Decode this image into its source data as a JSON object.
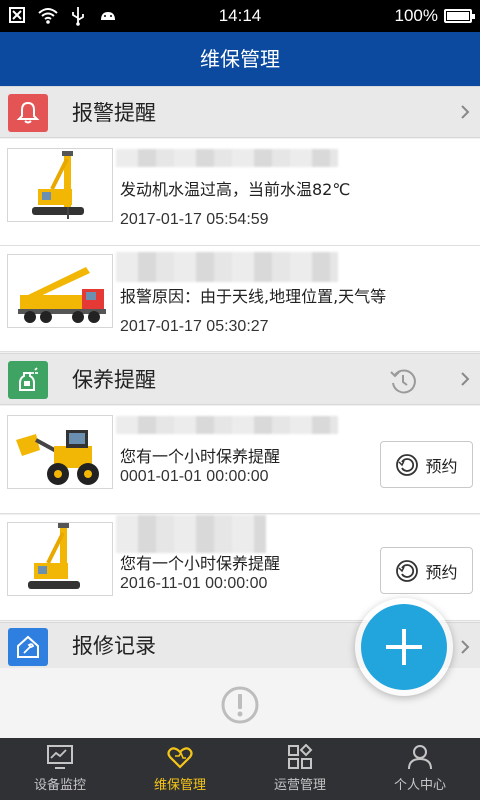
{
  "status_bar": {
    "time": "14:14",
    "battery_text": "100%",
    "battery_level": 1.0
  },
  "header": {
    "title": "维保管理"
  },
  "alarm_section": {
    "title": "报警提醒",
    "items": [
      {
        "message": "发动机水温过高，当前水温82℃",
        "timestamp": "2017-01-17 05:54:59",
        "thumbnail": "rotary-drilling-rig"
      },
      {
        "message": "报警原因：由于天线,地理位置,天气等",
        "timestamp": "2017-01-17 05:30:27",
        "thumbnail": "truck-crane"
      }
    ]
  },
  "maintenance_section": {
    "title": "保养提醒",
    "items": [
      {
        "message": "您有一个小时保养提醒",
        "timestamp": "0001-01-01 00:00:00",
        "button_label": "预约",
        "thumbnail": "wheel-loader"
      },
      {
        "message": "您有一个小时保养提醒",
        "timestamp": "2016-11-01 00:00:00",
        "button_label": "预约",
        "thumbnail": "rotary-drilling-rig"
      }
    ]
  },
  "repair_section": {
    "title": "报修记录"
  },
  "bottom_nav": [
    {
      "label": "设备监控",
      "icon": "monitor-icon",
      "active": false
    },
    {
      "label": "维保管理",
      "icon": "heart-icon",
      "active": true
    },
    {
      "label": "运营管理",
      "icon": "grid-icon",
      "active": false
    },
    {
      "label": "个人中心",
      "icon": "person-icon",
      "active": false
    }
  ],
  "colors": {
    "title_bar": "#0c4aa0",
    "alarm_icon_bg": "#e45454",
    "maintenance_icon_bg": "#3fa463",
    "repair_icon_bg": "#2f7fe0",
    "fab": "#22a5dc",
    "nav_active": "#f5c518"
  }
}
